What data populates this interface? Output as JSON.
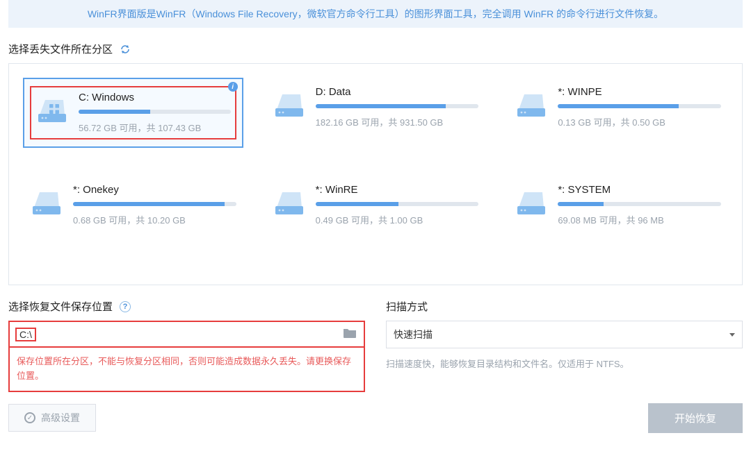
{
  "banner": "WinFR界面版是WinFR（Windows File Recovery，微软官方命令行工具）的图形界面工具，完全调用 WinFR 的命令行进行文件恢复。",
  "partition_section": {
    "title": "选择丢失文件所在分区"
  },
  "partitions": [
    {
      "name": "C: Windows",
      "free": "56.72 GB",
      "total": "107.43 GB",
      "used_pct": 47,
      "selected": true
    },
    {
      "name": "D: Data",
      "free": "182.16 GB",
      "total": "931.50 GB",
      "used_pct": 80,
      "selected": false
    },
    {
      "name": "*: WINPE",
      "free": "0.13 GB",
      "total": "0.50 GB",
      "used_pct": 74,
      "selected": false
    },
    {
      "name": "*: Onekey",
      "free": "0.68 GB",
      "total": "10.20 GB",
      "used_pct": 93,
      "selected": false
    },
    {
      "name": "*: WinRE",
      "free": "0.49 GB",
      "total": "1.00 GB",
      "used_pct": 51,
      "selected": false
    },
    {
      "name": "*: SYSTEM",
      "free": "69.08 MB",
      "total": "96 MB",
      "used_pct": 28,
      "selected": false
    }
  ],
  "stats_join": {
    "free_label": "可用，共"
  },
  "save_section": {
    "title": "选择恢复文件保存位置",
    "path_value": "C:\\",
    "error": "保存位置所在分区，不能与恢复分区相同，否则可能造成数据永久丢失。请更换保存位置。"
  },
  "scan_section": {
    "title": "扫描方式",
    "selected": "快速扫描",
    "desc": "扫描速度快，能够恢复目录结构和文件名。仅适用于 NTFS。"
  },
  "actions": {
    "advanced": "高级设置",
    "start": "开始恢复"
  }
}
